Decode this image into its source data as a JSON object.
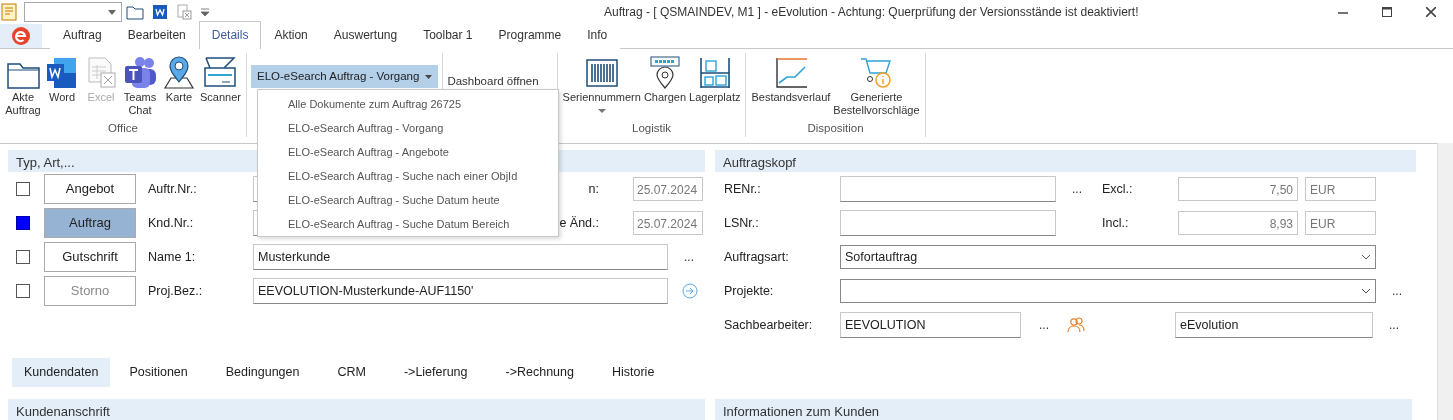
{
  "window": {
    "title": "Auftrag - [ QSMAINDEV, M1 ]  -  eEvolution - Achtung: Querprüfung der Versionsstände ist deaktiviert!"
  },
  "ribbon_tabs": [
    {
      "label": "Auftrag",
      "selected": false
    },
    {
      "label": "Bearbeiten",
      "selected": false
    },
    {
      "label": "Details",
      "selected": true
    },
    {
      "label": "Aktion",
      "selected": false
    },
    {
      "label": "Auswertung",
      "selected": false
    },
    {
      "label": "Toolbar 1",
      "selected": false
    },
    {
      "label": "Programme",
      "selected": false
    },
    {
      "label": "Info",
      "selected": false
    }
  ],
  "ribbon_groups": [
    {
      "label": "Office",
      "items": [
        {
          "kind": "large",
          "label": "Akte\nAuftrag",
          "disabled": false
        },
        {
          "kind": "large",
          "label": "Word",
          "disabled": false
        },
        {
          "kind": "large",
          "label": "Excel",
          "disabled": true
        },
        {
          "kind": "large",
          "label": "Teams\nChat",
          "disabled": false
        },
        {
          "kind": "large",
          "label": "Karte",
          "disabled": false
        },
        {
          "kind": "large",
          "label": "Scanner",
          "disabled": false
        }
      ]
    },
    {
      "items": [
        {
          "kind": "split",
          "label": "ELO-eSearch Auftrag - Vorgang",
          "expanded": true
        }
      ]
    },
    {
      "items": [
        {
          "kind": "text",
          "label": "Dashboard öffnen"
        }
      ]
    },
    {
      "label": "Logistik",
      "items": [
        {
          "kind": "menu",
          "label": "Seriennummern",
          "disabled": false
        },
        {
          "kind": "large",
          "label": "Chargen",
          "disabled": false
        },
        {
          "kind": "large",
          "label": "Lagerplatz",
          "disabled": false
        }
      ]
    },
    {
      "label": "Disposition",
      "items": [
        {
          "kind": "large",
          "label": "Bestandsverlauf",
          "disabled": false
        },
        {
          "kind": "large",
          "label": "Generierte\nBestellvorschläge",
          "disabled": false
        }
      ]
    }
  ],
  "dropdown_menu": {
    "items": [
      "Alle Dokumente zum Auftrag 26725",
      "ELO-eSearch Auftrag - Vorgang",
      "ELO-eSearch Auftrag - Angebote",
      "ELO-eSearch Auftrag - Suche nach einer ObjId",
      "ELO-eSearch Auftrag - Suche Datum heute",
      "ELO-eSearch Auftrag - Suche Datum Bereich"
    ]
  },
  "typ_panel": {
    "title": "Typ, Art,...",
    "rows": [
      {
        "kind": "short",
        "type": "Angebot",
        "selected": false,
        "disabled": false,
        "label": "Auftr.Nr.:",
        "side_label": "n:",
        "date": "25.07.2024"
      },
      {
        "kind": "short",
        "type": "Auftrag",
        "selected": true,
        "disabled": false,
        "label": "Knd.Nr.:",
        "side_label": "e Änd.:",
        "date": "25.07.2024"
      },
      {
        "kind": "long",
        "type": "Gutschrift",
        "selected": false,
        "disabled": false,
        "label": "Name 1:",
        "value": "Musterkunde",
        "more": "..."
      },
      {
        "kind": "link",
        "type": "Storno",
        "selected": false,
        "disabled": true,
        "label": "Proj.Bez.:",
        "value": "EEVOLUTION-Musterkunde-AUF1150'"
      }
    ]
  },
  "kopf_panel": {
    "title": "Auftragskopf",
    "rows": [
      {
        "kind": "ref",
        "label": "RENr.:",
        "more": "...",
        "amount_label": "Excl.:",
        "amount": "7,50",
        "currency": "EUR"
      },
      {
        "kind": "ref",
        "label": "LSNr.:",
        "amount_label": "Incl.:",
        "amount": "8,93",
        "currency": "EUR"
      },
      {
        "kind": "select",
        "label": "Auftragsart:",
        "value": "Sofortauftrag"
      },
      {
        "kind": "select",
        "label": "Projekte:",
        "more": "..."
      },
      {
        "kind": "person",
        "label": "Sachbearbeiter:",
        "value": "EEVOLUTION",
        "more": "...",
        "name": "eEvolution",
        "more2": "..."
      }
    ]
  },
  "detail_tabs": [
    {
      "label": "Kundendaten",
      "selected": true
    },
    {
      "label": "Positionen",
      "selected": false
    },
    {
      "label": "Bedingungen",
      "selected": false
    },
    {
      "label": "CRM",
      "selected": false
    },
    {
      "label": "->Lieferung",
      "selected": false
    },
    {
      "label": "->Rechnung",
      "selected": false
    },
    {
      "label": "Historie",
      "selected": false
    }
  ],
  "sections": [
    "Kundenanschrift",
    "Informationen zum Kunden"
  ]
}
